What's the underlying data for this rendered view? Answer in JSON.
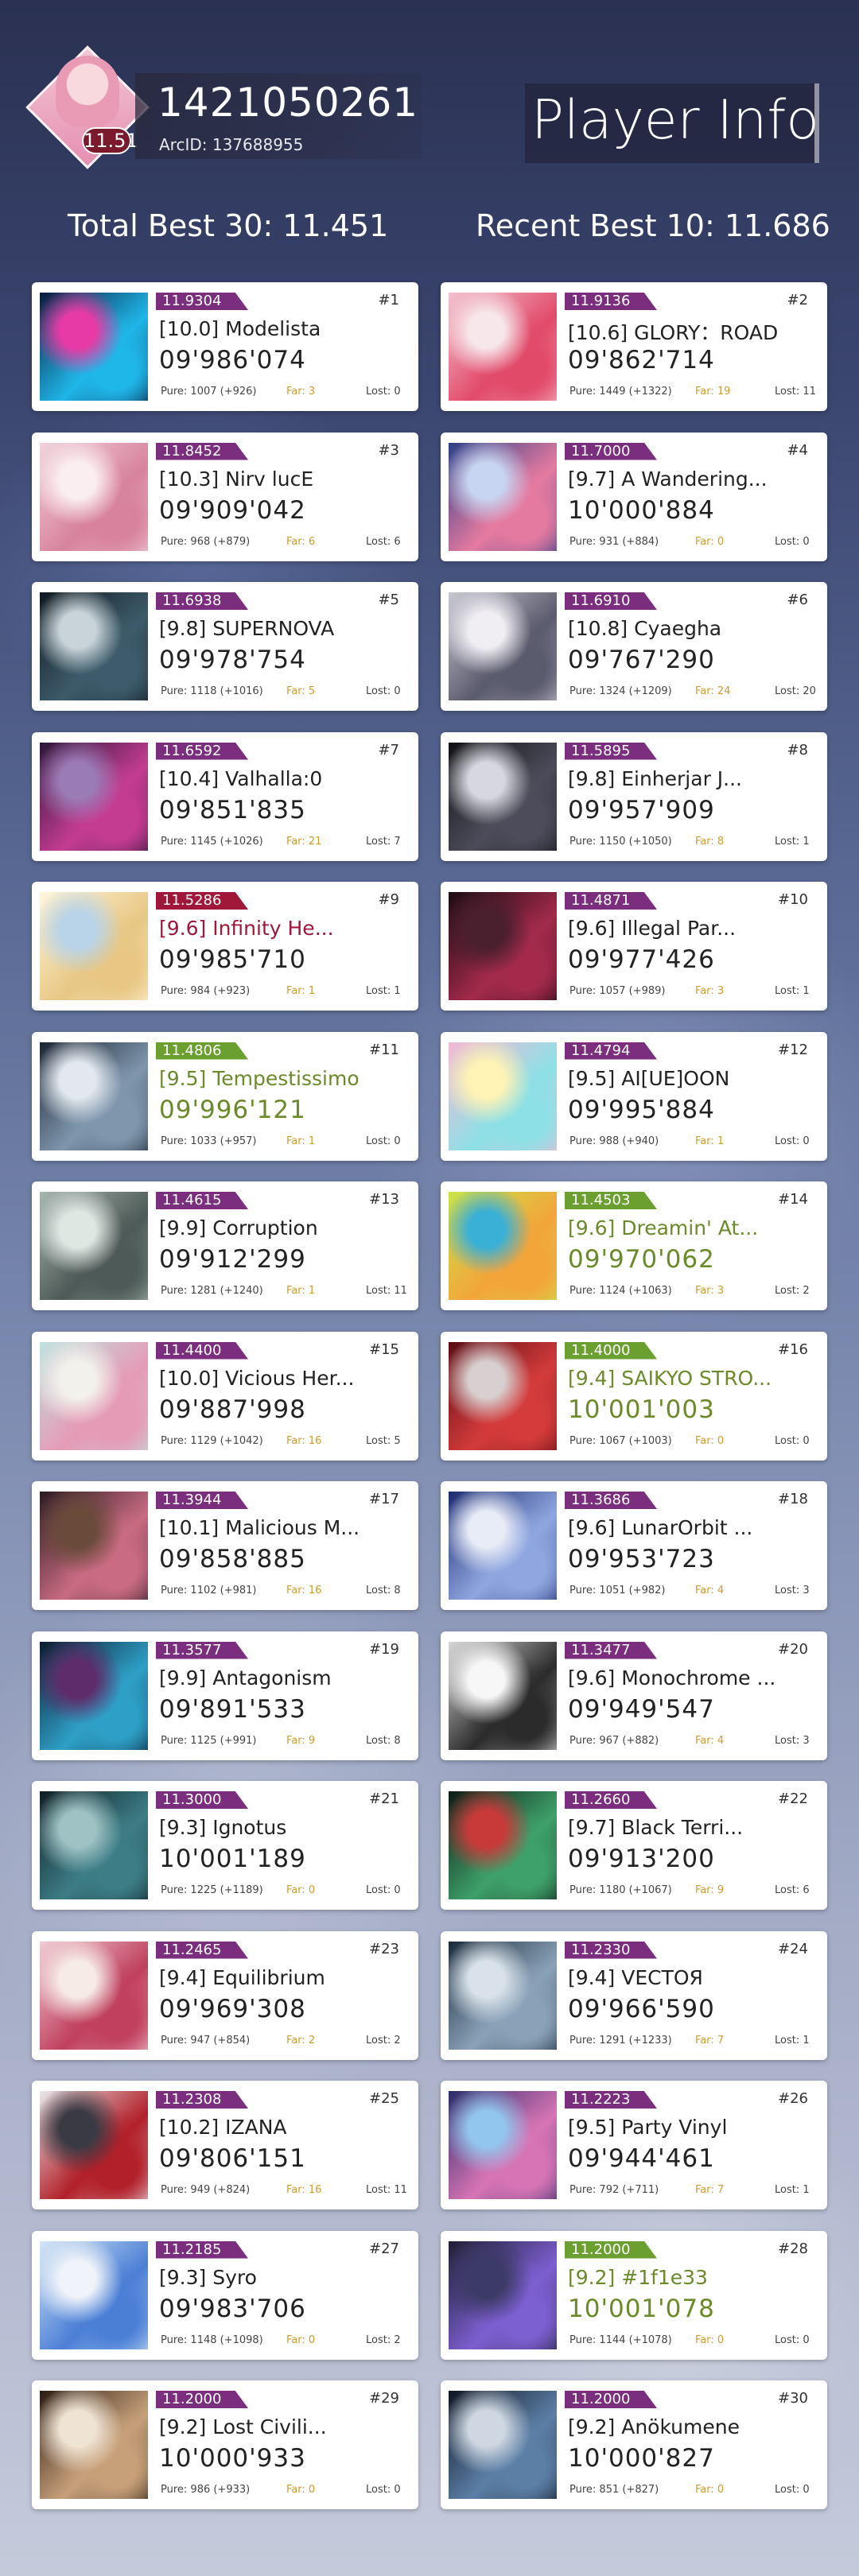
{
  "header": {
    "user_code": "1421050261",
    "arc_id": "ArcID: 137688955",
    "ptt": "11.51",
    "page_title": "Player Info",
    "total_best": "Total Best 30: 11.451",
    "recent_best": "Recent Best 10: 11.686"
  },
  "colors": {
    "future": "#7b2d7e",
    "present": "#6b9f2f",
    "beyond": "#a0173a",
    "far": "#d59a2a"
  },
  "records": [
    {
      "rank": "#1",
      "rating": "11.9304",
      "title": "[10.0] Modelista",
      "score": "09'986'074",
      "pure": "Pure: 1007 (+926)",
      "far": "Far: 3",
      "lost": "Lost: 0",
      "diff": "future",
      "jacket": [
        "#0b1a3a",
        "#1fb6e8",
        "#e83aa6"
      ]
    },
    {
      "rank": "#2",
      "rating": "11.9136",
      "title": "[10.6] GLORY：ROAD",
      "score": "09'862'714",
      "pure": "Pure: 1449 (+1322)",
      "far": "Far: 19",
      "lost": "Lost: 11",
      "diff": "future",
      "jacket": [
        "#f2c3d0",
        "#e24a6a",
        "#f7e6ea"
      ]
    },
    {
      "rank": "#3",
      "rating": "11.8452",
      "title": "[10.3] Nirv lucE",
      "score": "09'909'042",
      "pure": "Pure: 968 (+879)",
      "far": "Far: 6",
      "lost": "Lost: 6",
      "diff": "future",
      "jacket": [
        "#f1d3dc",
        "#d8839e",
        "#fbeef1"
      ]
    },
    {
      "rank": "#4",
      "rating": "11.7000",
      "title": "[9.7] A Wandering...",
      "score": "10'000'884",
      "pure": "Pure: 931 (+884)",
      "far": "Far: 0",
      "lost": "Lost: 0",
      "diff": "future",
      "jacket": [
        "#2c3f87",
        "#e57aa0",
        "#c7d5f2"
      ]
    },
    {
      "rank": "#5",
      "rating": "11.6938",
      "title": "[9.8] SUPERNOVA",
      "score": "09'978'754",
      "pure": "Pure: 1118 (+1016)",
      "far": "Far: 5",
      "lost": "Lost: 0",
      "diff": "future",
      "jacket": [
        "#101820",
        "#3d5b6a",
        "#c9d4d9"
      ]
    },
    {
      "rank": "#6",
      "rating": "11.6910",
      "title": "[10.8] Cyaegha",
      "score": "09'767'290",
      "pure": "Pure: 1324 (+1209)",
      "far": "Far: 24",
      "lost": "Lost: 20",
      "diff": "future",
      "jacket": [
        "#c8c8d2",
        "#5b5b6e",
        "#f0eef3"
      ]
    },
    {
      "rank": "#7",
      "rating": "11.6592",
      "title": "[10.4] Valhalla:0",
      "score": "09'851'835",
      "pure": "Pure: 1145 (+1026)",
      "far": "Far: 21",
      "lost": "Lost: 7",
      "diff": "future",
      "jacket": [
        "#2a1638",
        "#c43c92",
        "#9b7bb5"
      ]
    },
    {
      "rank": "#8",
      "rating": "11.5895",
      "title": "[9.8] Einherjar J...",
      "score": "09'957'909",
      "pure": "Pure: 1150 (+1050)",
      "far": "Far: 8",
      "lost": "Lost: 1",
      "diff": "future",
      "jacket": [
        "#101014",
        "#4c4c5a",
        "#d7d7df"
      ]
    },
    {
      "rank": "#9",
      "rating": "11.5286",
      "title": "[9.6] Infinity He...",
      "score": "09'985'710",
      "pure": "Pure: 984 (+923)",
      "far": "Far: 1",
      "lost": "Lost: 1",
      "diff": "beyond",
      "jacket": [
        "#fff6dc",
        "#e8c784",
        "#b9d4e8"
      ]
    },
    {
      "rank": "#10",
      "rating": "11.4871",
      "title": "[9.6] Illegal Par...",
      "score": "09'977'426",
      "pure": "Pure: 1057 (+989)",
      "far": "Far: 3",
      "lost": "Lost: 1",
      "diff": "future",
      "jacket": [
        "#1a0b12",
        "#a32a4b",
        "#4a1f2e"
      ]
    },
    {
      "rank": "#11",
      "rating": "11.4806",
      "title": "[9.5] Tempestissimo",
      "score": "09'996'121",
      "pure": "Pure: 1033 (+957)",
      "far": "Far: 1",
      "lost": "Lost: 0",
      "diff": "present",
      "jacket": [
        "#1c2432",
        "#7f96ad",
        "#e2e8ee"
      ]
    },
    {
      "rank": "#12",
      "rating": "11.4794",
      "title": "[9.5] AI[UE]OON",
      "score": "09'995'884",
      "pure": "Pure: 988 (+940)",
      "far": "Far: 1",
      "lost": "Lost: 0",
      "diff": "future",
      "jacket": [
        "#f4b8d4",
        "#8de0e6",
        "#fff3b5"
      ]
    },
    {
      "rank": "#13",
      "rating": "11.4615",
      "title": "[9.9] Corruption",
      "score": "09'912'299",
      "pure": "Pure: 1281 (+1240)",
      "far": "Far: 1",
      "lost": "Lost: 11",
      "diff": "future",
      "jacket": [
        "#a8b6b0",
        "#4e5a57",
        "#dfe7e3"
      ]
    },
    {
      "rank": "#14",
      "rating": "11.4503",
      "title": "[9.6] Dreamin' At...",
      "score": "09'970'062",
      "pure": "Pure: 1124 (+1063)",
      "far": "Far: 3",
      "lost": "Lost: 2",
      "diff": "present",
      "jacket": [
        "#c9e44a",
        "#f3a53a",
        "#3ab0d6"
      ]
    },
    {
      "rank": "#15",
      "rating": "11.4400",
      "title": "[10.0] Vicious Her...",
      "score": "09'887'998",
      "pure": "Pure: 1129 (+1042)",
      "far": "Far: 16",
      "lost": "Lost: 5",
      "diff": "future",
      "jacket": [
        "#bfe3df",
        "#e59ab6",
        "#f3f1ec"
      ]
    },
    {
      "rank": "#16",
      "rating": "11.4000",
      "title": "[9.4] SAIKYO STRO...",
      "score": "10'001'003",
      "pure": "Pure: 1067 (+1003)",
      "far": "Far: 0",
      "lost": "Lost: 0",
      "diff": "present",
      "jacket": [
        "#5a0c14",
        "#d43b3b",
        "#d8d0d0"
      ]
    },
    {
      "rank": "#17",
      "rating": "11.3944",
      "title": "[10.1] Malicious M...",
      "score": "09'858'885",
      "pure": "Pure: 1102 (+981)",
      "far": "Far: 16",
      "lost": "Lost: 8",
      "diff": "future",
      "jacket": [
        "#2a1a22",
        "#c96b82",
        "#6a4a3a"
      ]
    },
    {
      "rank": "#18",
      "rating": "11.3686",
      "title": "[9.6] LunarOrbit ...",
      "score": "09'953'723",
      "pure": "Pure: 1051 (+982)",
      "far": "Far: 4",
      "lost": "Lost: 3",
      "diff": "future",
      "jacket": [
        "#1b2a6e",
        "#8fa6e0",
        "#e8ecf7"
      ]
    },
    {
      "rank": "#19",
      "rating": "11.3577",
      "title": "[9.9] Antagonism",
      "score": "09'891'533",
      "pure": "Pure: 1125 (+991)",
      "far": "Far: 9",
      "lost": "Lost: 8",
      "diff": "future",
      "jacket": [
        "#0d1a2e",
        "#2ea0c7",
        "#5e2c6a"
      ]
    },
    {
      "rank": "#20",
      "rating": "11.3477",
      "title": "[9.6] Monochrome ...",
      "score": "09'949'547",
      "pure": "Pure: 967 (+882)",
      "far": "Far: 4",
      "lost": "Lost: 3",
      "diff": "future",
      "jacket": [
        "#d9d9d9",
        "#2b2b2b",
        "#f7f7f7"
      ]
    },
    {
      "rank": "#21",
      "rating": "11.3000",
      "title": "[9.3] Ignotus",
      "score": "10'001'189",
      "pure": "Pure: 1225 (+1189)",
      "far": "Far: 0",
      "lost": "Lost: 0",
      "diff": "future",
      "jacket": [
        "#0f1e24",
        "#3d7d86",
        "#9fc3c5"
      ]
    },
    {
      "rank": "#22",
      "rating": "11.2660",
      "title": "[9.7] Black Terri...",
      "score": "09'913'200",
      "pure": "Pure: 1180 (+1067)",
      "far": "Far: 9",
      "lost": "Lost: 6",
      "diff": "future",
      "jacket": [
        "#0e1a14",
        "#3ea06a",
        "#c83a3a"
      ]
    },
    {
      "rank": "#23",
      "rating": "11.2465",
      "title": "[9.4] Equilibrium",
      "score": "09'969'308",
      "pure": "Pure: 947 (+854)",
      "far": "Far: 2",
      "lost": "Lost: 2",
      "diff": "future",
      "jacket": [
        "#f0ccd5",
        "#c0405e",
        "#f7ebe6"
      ]
    },
    {
      "rank": "#24",
      "rating": "11.2330",
      "title": "[9.4] VECTOЯ",
      "score": "09'966'590",
      "pure": "Pure: 1291 (+1233)",
      "far": "Far: 7",
      "lost": "Lost: 1",
      "diff": "future",
      "jacket": [
        "#1b2a3a",
        "#8aa2b8",
        "#d9e2ea"
      ]
    },
    {
      "rank": "#25",
      "rating": "11.2308",
      "title": "[10.2] IZANA",
      "score": "09'806'151",
      "pure": "Pure: 949 (+824)",
      "far": "Far: 16",
      "lost": "Lost: 11",
      "diff": "future",
      "jacket": [
        "#e8e8ea",
        "#b2202a",
        "#3a3a44"
      ]
    },
    {
      "rank": "#26",
      "rating": "11.2223",
      "title": "[9.5] Party Vinyl",
      "score": "09'944'461",
      "pure": "Pure: 792 (+711)",
      "far": "Far: 7",
      "lost": "Lost: 1",
      "diff": "future",
      "jacket": [
        "#2a2c6a",
        "#d774b5",
        "#92c6ee"
      ]
    },
    {
      "rank": "#27",
      "rating": "11.2185",
      "title": "[9.3] Syro",
      "score": "09'983'706",
      "pure": "Pure: 1148 (+1098)",
      "far": "Far: 0",
      "lost": "Lost: 2",
      "diff": "future",
      "jacket": [
        "#d6e7f6",
        "#4b7fd6",
        "#f0f4fa"
      ]
    },
    {
      "rank": "#28",
      "rating": "11.2000",
      "title": "[9.2] #1f1e33",
      "score": "10'001'078",
      "pure": "Pure: 1144 (+1078)",
      "far": "Far: 0",
      "lost": "Lost: 0",
      "diff": "present",
      "jacket": [
        "#1f1e33",
        "#7c5fd0",
        "#3c3a66"
      ]
    },
    {
      "rank": "#29",
      "rating": "11.2000",
      "title": "[9.2] Lost Civili...",
      "score": "10'000'933",
      "pure": "Pure: 986 (+933)",
      "far": "Far: 0",
      "lost": "Lost: 0",
      "diff": "future",
      "jacket": [
        "#2a1a12",
        "#c7a07a",
        "#efe3d3"
      ]
    },
    {
      "rank": "#30",
      "rating": "11.2000",
      "title": "[9.2] Anökumene",
      "score": "10'000'827",
      "pure": "Pure: 851 (+827)",
      "far": "Far: 0",
      "lost": "Lost: 0",
      "diff": "future",
      "jacket": [
        "#0f1522",
        "#5c7fa6",
        "#cfd8e2"
      ]
    }
  ]
}
